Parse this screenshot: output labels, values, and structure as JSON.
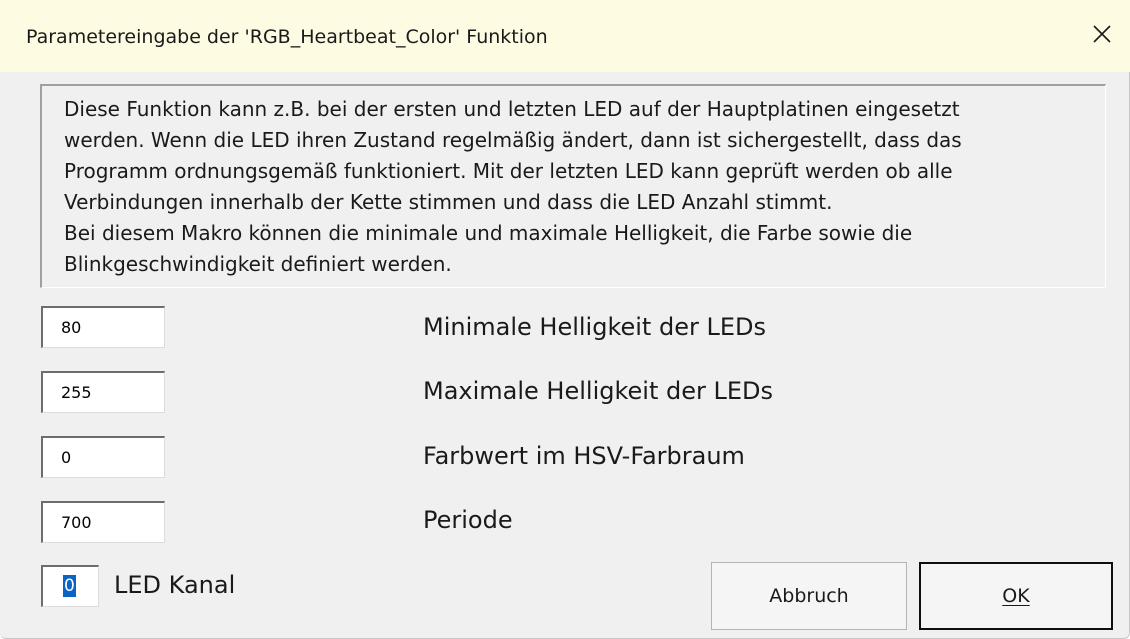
{
  "window": {
    "title": "Parametereingabe der 'RGB_Heartbeat_Color' Funktion",
    "close_icon": "close-icon"
  },
  "description": {
    "lines": [
      "Diese Funktion kann z.B. bei der ersten und letzten LED auf der Hauptplatinen eingesetzt",
      "werden. Wenn die LED ihren Zustand regelmäßig ändert, dann ist sichergestellt, dass das",
      "Programm ordnungsgemäß funktioniert. Mit der letzten LED kann geprüft werden ob alle",
      "Verbindungen innerhalb der Kette stimmen und dass die LED Anzahl stimmt.",
      "Bei diesem Makro können die minimale und maximale Helligkeit, die Farbe sowie die",
      "Blinkgeschwindigkeit definiert werden."
    ]
  },
  "fields": [
    {
      "value": "80",
      "label": "Minimale Helligkeit der LEDs"
    },
    {
      "value": "255",
      "label": "Maximale Helligkeit der LEDs"
    },
    {
      "value": "0",
      "label": "Farbwert im HSV-Farbraum"
    },
    {
      "value": "700",
      "label": "Periode"
    }
  ],
  "kanal": {
    "value": "0",
    "label": "LED Kanal"
  },
  "buttons": {
    "cancel": "Abbruch",
    "ok": "OK"
  },
  "colors": {
    "titlebar": "#fdfbe2",
    "dialog_bg": "#f0f0f0",
    "selection": "#0a63c5"
  }
}
